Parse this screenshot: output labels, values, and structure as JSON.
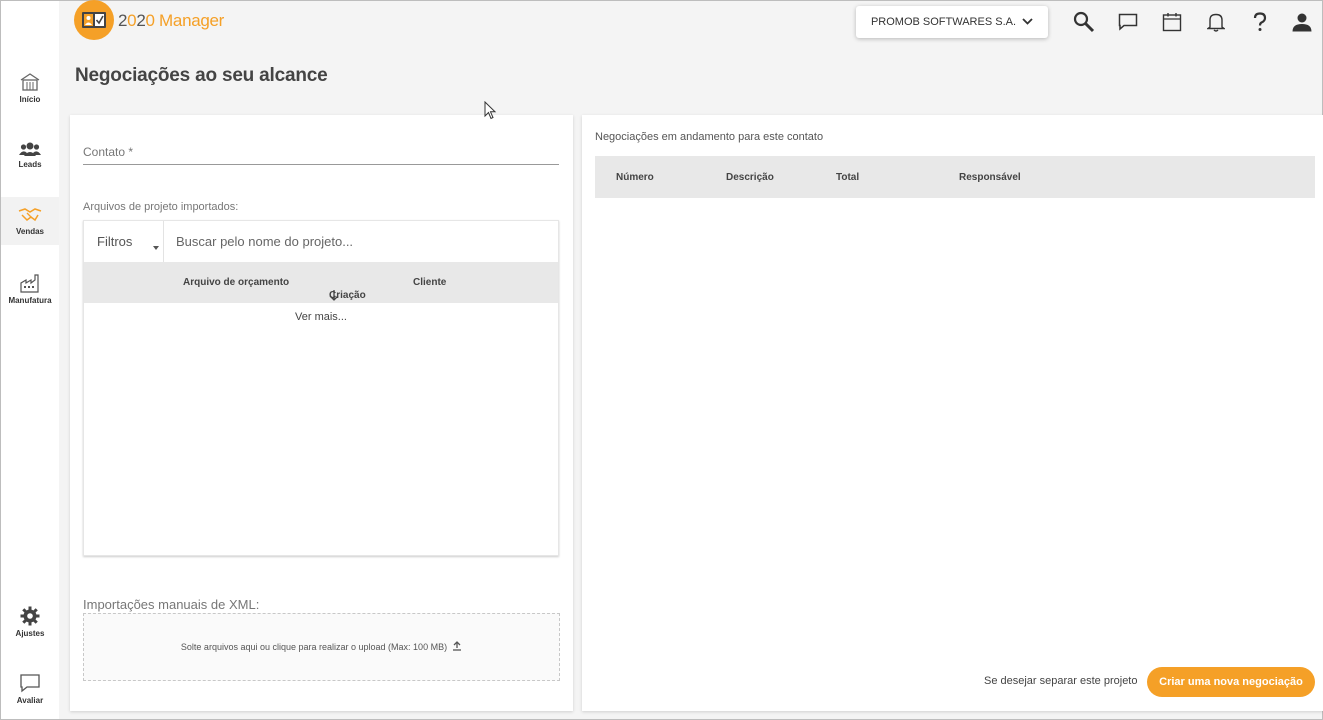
{
  "app": {
    "logo_text_prefix": "2",
    "logo_text_zero": "0",
    "logo_text_suffix": "2",
    "logo_text_zero2": "0",
    "logo_text_manager": " Manager",
    "brand_color": "#f5a027"
  },
  "sidebar": {
    "items": [
      {
        "label": "Início",
        "icon": "home-icon"
      },
      {
        "label": "Leads",
        "icon": "people-icon"
      },
      {
        "label": "Vendas",
        "icon": "handshake-icon",
        "active": true
      },
      {
        "label": "Manufatura",
        "icon": "factory-icon"
      },
      {
        "label": "Ajustes",
        "icon": "gear-icon"
      },
      {
        "label": "Avaliar",
        "icon": "chat-bubble-icon"
      }
    ]
  },
  "header": {
    "company": "PROMOB SOFTWARES S.A.",
    "icons": [
      "search-icon",
      "message-icon",
      "calendar-icon",
      "bell-icon",
      "help-icon",
      "user-icon"
    ]
  },
  "page": {
    "title": "Negociações ao seu alcance"
  },
  "left": {
    "contact_label": "Contato *",
    "files_label": "Arquivos de projeto importados:",
    "filter_label": "Filtros",
    "search_placeholder": "Buscar pelo nome do projeto...",
    "columns": [
      "Arquivo de orçamento",
      "Criação",
      "Cliente"
    ],
    "sort_column": "Criação",
    "ver_mais": "Ver mais...",
    "xml_label": "Importações manuais de XML:",
    "dropzone_text": "Solte arquivos aqui ou clique para realizar o upload (Max: 100 MB)"
  },
  "right": {
    "label": "Negociações em andamento para este contato",
    "columns": [
      "Número",
      "Descrição",
      "Total",
      "Responsável"
    ],
    "footer_text": "Se desejar separar este projeto",
    "new_deal_button": "Criar uma nova negociação"
  }
}
